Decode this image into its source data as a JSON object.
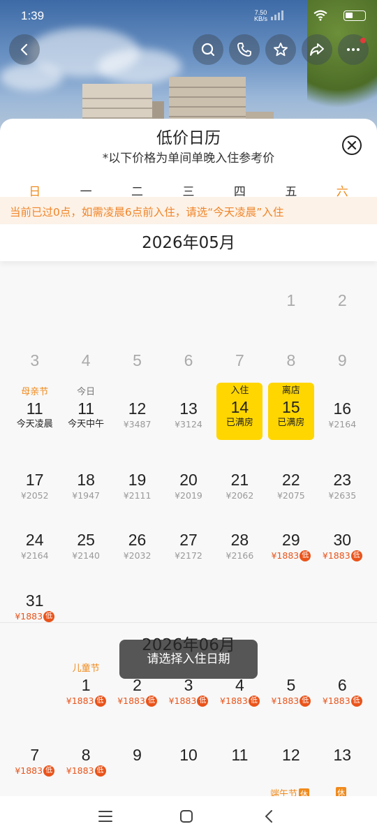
{
  "status": {
    "time": "1:39",
    "speed_top": "7.50",
    "speed_bottom": "KB/s"
  },
  "sheet": {
    "title": "低价日历",
    "subtitle": "*以下价格为单间单晚入住参考价"
  },
  "weekdays": [
    "日",
    "一",
    "二",
    "三",
    "四",
    "五",
    "六"
  ],
  "notice": "当前已过0点，如需凌晨6点前入住，请选“今天凌晨”入住",
  "month1": {
    "label": "2026年05月",
    "row1": [
      {
        "num": "1",
        "col": 5,
        "past": true
      },
      {
        "num": "2",
        "col": 6,
        "past": true
      }
    ],
    "row2": [
      {
        "num": "3",
        "past": true
      },
      {
        "num": "4",
        "past": true
      },
      {
        "num": "5",
        "past": true
      },
      {
        "num": "6",
        "past": true
      },
      {
        "num": "7",
        "past": true
      },
      {
        "num": "8",
        "past": true
      },
      {
        "num": "9",
        "past": true
      }
    ],
    "row3": [
      {
        "top": "母亲节",
        "num": "11",
        "price": "今天凌晨"
      },
      {
        "top": "今日",
        "num": "11",
        "price": "今天中午"
      },
      {
        "top": "",
        "num": "12",
        "price": "¥3487"
      },
      {
        "top": "",
        "num": "13",
        "price": "¥3124"
      },
      {
        "top": "入住",
        "num": "14",
        "price": "已满房"
      },
      {
        "top": "离店",
        "num": "15",
        "price": "已满房"
      },
      {
        "top": "",
        "num": "16",
        "price": "¥2164"
      }
    ],
    "row4": [
      {
        "num": "17",
        "price": "¥2052"
      },
      {
        "num": "18",
        "price": "¥1947"
      },
      {
        "num": "19",
        "price": "¥2111"
      },
      {
        "num": "20",
        "price": "¥2019"
      },
      {
        "num": "21",
        "price": "¥2062"
      },
      {
        "num": "22",
        "price": "¥2075"
      },
      {
        "num": "23",
        "price": "¥2635"
      }
    ],
    "row5": [
      {
        "num": "24",
        "price": "¥2164"
      },
      {
        "num": "25",
        "price": "¥2140"
      },
      {
        "num": "26",
        "price": "¥2032"
      },
      {
        "num": "27",
        "price": "¥2172"
      },
      {
        "num": "28",
        "price": "¥2166"
      },
      {
        "num": "29",
        "price": "¥1883"
      },
      {
        "num": "30",
        "price": "¥1883"
      }
    ],
    "row6": [
      {
        "num": "31",
        "price": "¥1883"
      }
    ]
  },
  "low_badge": "低",
  "month2": {
    "label": "2026年06月",
    "row1": [
      {
        "top": "儿童节",
        "num": "1",
        "price": "¥1883"
      },
      {
        "top": "",
        "num": "2",
        "price": "¥1883"
      },
      {
        "top": "",
        "num": "3",
        "price": "¥1883"
      },
      {
        "top": "",
        "num": "4",
        "price": "¥1883"
      },
      {
        "top": "",
        "num": "5",
        "price": "¥1883"
      },
      {
        "top": "",
        "num": "6",
        "price": "¥1883"
      }
    ],
    "row2": [
      {
        "num": "7",
        "price": "¥1883"
      },
      {
        "num": "8",
        "price": "¥1883"
      },
      {
        "num": "9",
        "price": ""
      },
      {
        "num": "10",
        "price": ""
      },
      {
        "num": "11",
        "price": ""
      },
      {
        "num": "12",
        "price": ""
      },
      {
        "num": "13",
        "price": ""
      }
    ],
    "partial": {
      "holiday": "端午节",
      "rest": "休"
    }
  },
  "toast": "请选择入住日期",
  "icons": {
    "back": "chevron-left-icon",
    "search": "search-icon",
    "phone": "phone-icon",
    "star": "star-icon",
    "share": "share-icon",
    "more": "more-icon",
    "close": "close-icon"
  },
  "colors": {
    "accent_orange": "#f08a1c",
    "selected_yellow": "#ffd600",
    "low_red": "#e9541b"
  }
}
